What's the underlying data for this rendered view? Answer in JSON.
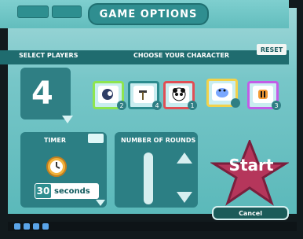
{
  "header": {
    "title": "GAME OPTIONS"
  },
  "labels": {
    "select_players": "SELECT PLAYERS",
    "choose_character": "CHOOSE YOUR CHARACTER",
    "reset": "RESET"
  },
  "players": {
    "count": "4"
  },
  "characters": [
    {
      "badge": "2"
    },
    {
      "badge": "4"
    },
    {
      "badge": "1"
    },
    {
      "badge": ""
    },
    {
      "badge": "3"
    }
  ],
  "timer": {
    "title": "TIMER",
    "value": "30",
    "unit": "seconds"
  },
  "rounds": {
    "title": "NUMBER OF ROUNDS"
  },
  "actions": {
    "start": "Start",
    "cancel": "Cancel"
  },
  "colors": {
    "accent": "#2f8e90",
    "star": "#b5365b"
  },
  "icons": [
    "clock-icon",
    "arrow-down-icon",
    "arrow-up-icon",
    "star-icon"
  ]
}
